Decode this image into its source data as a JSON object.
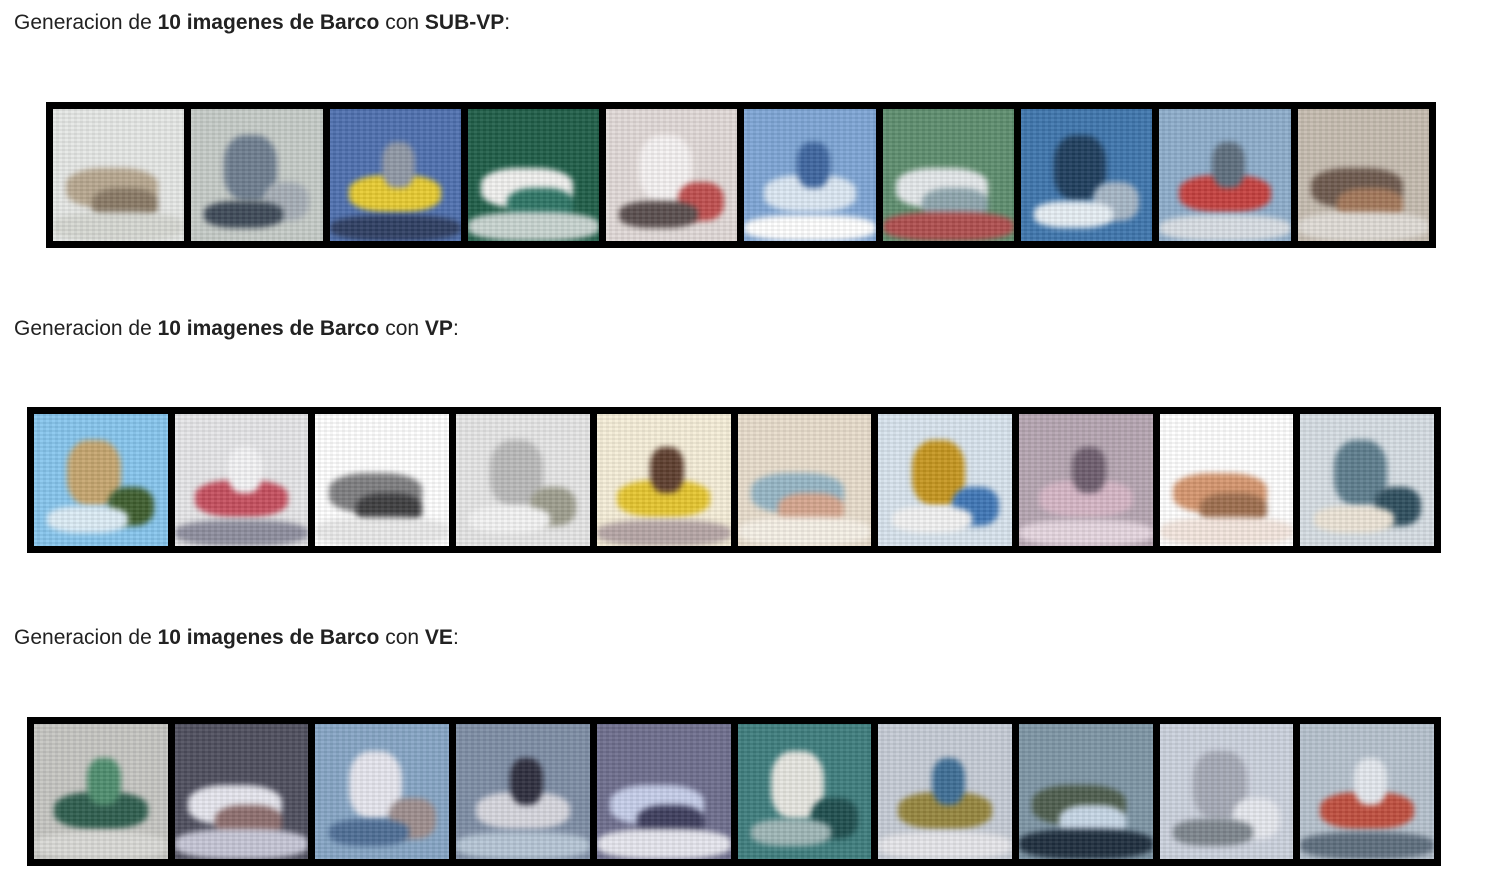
{
  "sections": [
    {
      "caption": {
        "prefix": "Generacion de ",
        "count_label": "10 imagenes de Barco",
        "middle": " con ",
        "method": "SUB-VP",
        "suffix": ":"
      },
      "images": [
        {
          "bg": "#e6e8e6",
          "colors": [
            "#b8a890",
            "#8a7a66",
            "#d6d8d2"
          ]
        },
        {
          "bg": "#c6ccc8",
          "colors": [
            "#6e7e90",
            "#a6aeb6",
            "#3e4a58"
          ]
        },
        {
          "bg": "#4e70b0",
          "colors": [
            "#e8cc30",
            "#9098a6",
            "#2e3e62"
          ]
        },
        {
          "bg": "#1e5e48",
          "colors": [
            "#f0f0ee",
            "#2e7666",
            "#c8d4d0"
          ]
        },
        {
          "bg": "#e2dad8",
          "colors": [
            "#f6f2f2",
            "#c04e4e",
            "#5a4e4e"
          ]
        },
        {
          "bg": "#7ea6d6",
          "colors": [
            "#dce8f4",
            "#3e66a0",
            "#ffffff"
          ]
        },
        {
          "bg": "#5e8e6e",
          "colors": [
            "#e4e8ea",
            "#8ea6ae",
            "#b04e4e"
          ]
        },
        {
          "bg": "#3e76ae",
          "colors": [
            "#1e3e5e",
            "#a6b6c6",
            "#e6eef4"
          ]
        },
        {
          "bg": "#8eaecc",
          "colors": [
            "#c6403e",
            "#5e6e7e",
            "#d8dee4"
          ]
        },
        {
          "bg": "#c6bcb0",
          "colors": [
            "#6e5a4e",
            "#a4785a",
            "#e0dcd6"
          ]
        }
      ]
    },
    {
      "caption": {
        "prefix": "Generacion de ",
        "count_label": "10 imagenes de Barco",
        "middle": " con ",
        "method": "VP",
        "suffix": ":"
      },
      "images": [
        {
          "bg": "#86c6ee",
          "colors": [
            "#c6a66e",
            "#3e5e2e",
            "#dcecf6"
          ]
        },
        {
          "bg": "#e6e6e8",
          "colors": [
            "#c64e5e",
            "#f4f4f6",
            "#8e8e9e"
          ]
        },
        {
          "bg": "#ffffff",
          "colors": [
            "#7e7e80",
            "#3e3e40",
            "#eaeaea"
          ]
        },
        {
          "bg": "#e6e6e6",
          "colors": [
            "#bababa",
            "#9e9e8e",
            "#f4f4f4"
          ]
        },
        {
          "bg": "#f6eed8",
          "colors": [
            "#e6c62e",
            "#5e3e2e",
            "#b6a6a6"
          ]
        },
        {
          "bg": "#e8ddcc",
          "colors": [
            "#96b6c6",
            "#d6a68e",
            "#f6f0e6"
          ]
        },
        {
          "bg": "#d8e4ee",
          "colors": [
            "#c6961e",
            "#3e76b6",
            "#f2f2f2"
          ]
        },
        {
          "bg": "#b6a6b2",
          "colors": [
            "#d6b6c6",
            "#6e5e6e",
            "#e6d6e0"
          ]
        },
        {
          "bg": "#ffffff",
          "colors": [
            "#d6966e",
            "#9e6e4e",
            "#f4e6de"
          ]
        },
        {
          "bg": "#d6dee4",
          "colors": [
            "#5e7e8e",
            "#2e4e5e",
            "#ece4d6"
          ]
        }
      ]
    },
    {
      "caption": {
        "prefix": "Generacion de ",
        "count_label": "10 imagenes de Barco",
        "middle": " con ",
        "method": "VE",
        "suffix": ":"
      },
      "images": [
        {
          "bg": "#c6c6c2",
          "colors": [
            "#2e5e4e",
            "#4e8e6e",
            "#dadad6"
          ]
        },
        {
          "bg": "#4e4e5e",
          "colors": [
            "#e6e6ee",
            "#8e6e6e",
            "#c6c6d6"
          ]
        },
        {
          "bg": "#86a6c6",
          "colors": [
            "#e6e6ee",
            "#9e8e8e",
            "#4e6e96"
          ]
        },
        {
          "bg": "#7e8ea6",
          "colors": [
            "#d6d6de",
            "#2e2e3e",
            "#b6c6d6"
          ]
        },
        {
          "bg": "#6e6e8e",
          "colors": [
            "#c6ceea",
            "#3e3e5e",
            "#e6e6ee"
          ]
        },
        {
          "bg": "#3e7e7e",
          "colors": [
            "#e6e6e0",
            "#1e4e4e",
            "#9eb6b6"
          ]
        },
        {
          "bg": "#c6ccd6",
          "colors": [
            "#96863e",
            "#3e6e96",
            "#e6e6ea"
          ]
        },
        {
          "bg": "#7e96a6",
          "colors": [
            "#4e5e4e",
            "#c6d6e6",
            "#1e2e3e"
          ]
        },
        {
          "bg": "#ccd2de",
          "colors": [
            "#a6aab6",
            "#e6e8ee",
            "#7e868e"
          ]
        },
        {
          "bg": "#b6c2ce",
          "colors": [
            "#c04e3e",
            "#e4e8ee",
            "#5e6e7e"
          ]
        }
      ]
    }
  ]
}
